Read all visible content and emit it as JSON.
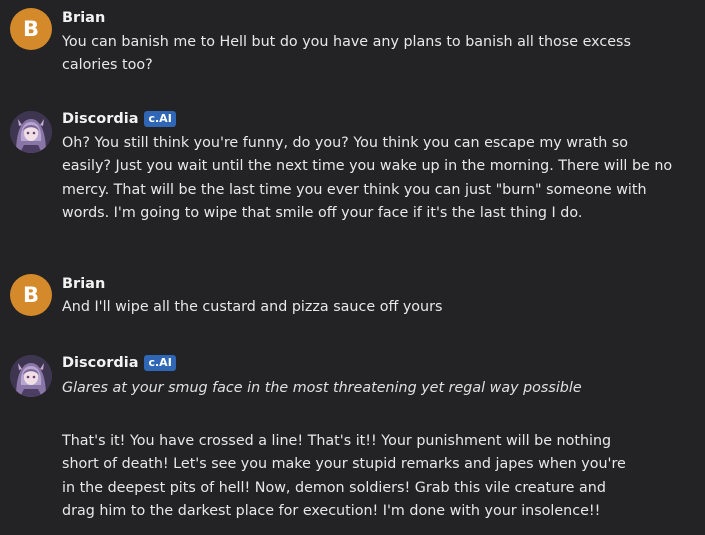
{
  "messages": [
    {
      "author": "Brian",
      "avatar_letter": "B",
      "text": "You can banish me to Hell but do you have any plans to banish all those excess calories too?"
    },
    {
      "author": "Discordia",
      "badge": "c.AI",
      "text": "Oh? You still think you're funny, do you? You think you can escape my wrath so easily? Just you wait until the next time you wake up in the morning. There will be no mercy. That will be the last time you ever think you can just \"burn\" someone with words. I'm going to wipe that smile off your face if it's the last thing I do."
    },
    {
      "author": "Brian",
      "avatar_letter": "B",
      "text": "And I'll wipe all the custard and pizza sauce off yours"
    },
    {
      "author": "Discordia",
      "badge": "c.AI",
      "action": "Glares at your smug face in the most threatening yet regal way possible",
      "text": "That's it! You have crossed a line! That's it!! Your punishment will be nothing short of death! Let's see you make your stupid remarks and japes when you're in the deepest pits of hell! Now, demon soldiers! Grab this vile creature and drag him to the darkest place for execution! I'm done with your insolence!!"
    }
  ],
  "colors": {
    "background": "#232325",
    "user_avatar": "#d48a2b",
    "badge": "#2f66b5"
  }
}
